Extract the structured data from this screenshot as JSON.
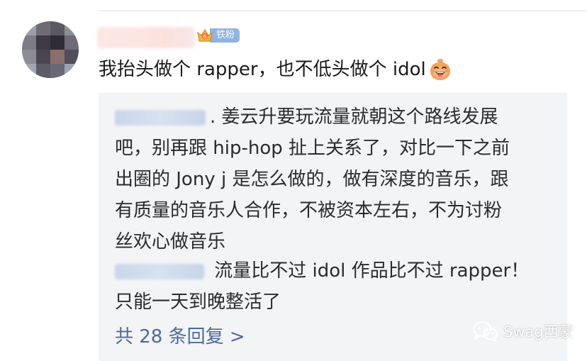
{
  "comment": {
    "fan_badge_label": "铁粉",
    "text": "我抬头做个 rapper，也不低头做个 idol",
    "emoji_icon": "laughing-face-icon"
  },
  "replies": [
    {
      "separator": ".",
      "text_lines": [
        "姜云升要玩流量就朝这个路线发展",
        "吧，别再跟 hip-hop 扯上关系了，对比一下之前",
        "出圈的 Jony j 是怎么做的，做有深度的音乐，跟",
        "有质量的音乐人合作，不被资本左右，不为讨粉",
        "丝欢心做音乐"
      ]
    },
    {
      "text_lines": [
        "流量比不过 idol 作品比不过 rapper！",
        "只能一天到晚整活了"
      ]
    }
  ],
  "reply_count_label": "共 28 条回复 >",
  "watermark": {
    "text": "Swag西蒙",
    "icon": "wechat-icon"
  },
  "colors": {
    "badge": "#8fb4e6",
    "link": "#4b6aa0",
    "reply_bg": "#f3f4f6"
  }
}
